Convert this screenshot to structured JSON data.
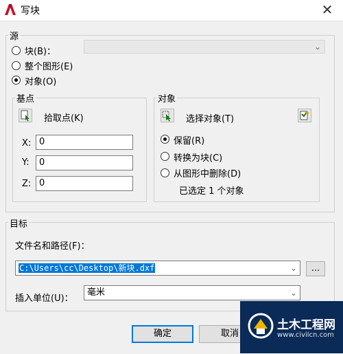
{
  "dialog": {
    "title": "写块"
  },
  "source": {
    "group_label": "源",
    "options": [
      {
        "label": "块(B)：",
        "checked": false
      },
      {
        "label": "整个图形(E)",
        "checked": false
      },
      {
        "label": "对象(O)",
        "checked": true
      }
    ],
    "block_combo_value": ""
  },
  "base_point": {
    "group_label": "基点",
    "pick_label": "拾取点(K)",
    "x_label": "X:",
    "x_value": "0",
    "y_label": "Y:",
    "y_value": "0",
    "z_label": "Z:",
    "z_value": "0"
  },
  "objects": {
    "group_label": "对象",
    "select_label": "选择对象(T)",
    "options": [
      {
        "label": "保留(R)",
        "checked": true
      },
      {
        "label": "转换为块(C)",
        "checked": false
      },
      {
        "label": "从图形中删除(D)",
        "checked": false
      }
    ],
    "status": "已选定 1 个对象"
  },
  "destination": {
    "group_label": "目标",
    "path_label": "文件名和路径(F)：",
    "path_value": "C:\\Users\\cc\\Desktop\\新块.dxf",
    "browse_label": "...",
    "units_label": "插入单位(U)：",
    "units_value": "毫米"
  },
  "buttons": {
    "ok": "确定",
    "cancel": "取消"
  },
  "watermark": {
    "text": "土木工程网",
    "url": "www.civilcn.com"
  },
  "colors": {
    "accent": "#0078d7",
    "watermark_bg": "#0a2a57"
  }
}
